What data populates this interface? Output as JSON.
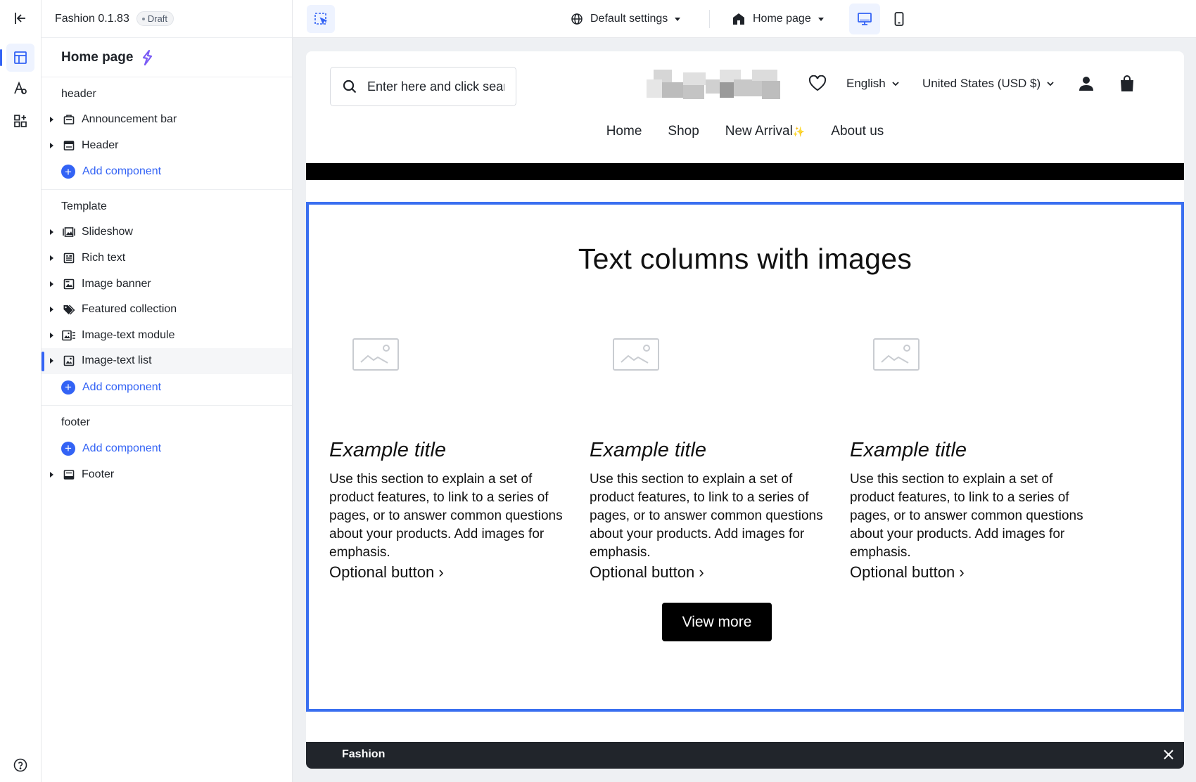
{
  "panel": {
    "app_name": "Fashion 0.1.83",
    "draft_label": "Draft",
    "page_title": "Home page",
    "groups": [
      {
        "title": "header",
        "items": [
          {
            "label": "Announcement bar",
            "icon": "announcement-icon"
          },
          {
            "label": "Header",
            "icon": "header-icon"
          }
        ],
        "add_label": "Add component"
      },
      {
        "title": "Template",
        "items": [
          {
            "label": "Slideshow",
            "icon": "slideshow-icon"
          },
          {
            "label": "Rich text",
            "icon": "rich-text-icon"
          },
          {
            "label": "Image banner",
            "icon": "image-banner-icon"
          },
          {
            "label": "Featured collection",
            "icon": "featured-collection-icon"
          },
          {
            "label": "Image-text module",
            "icon": "image-text-module-icon"
          },
          {
            "label": "Image-text list",
            "icon": "image-text-list-icon",
            "selected": true
          }
        ],
        "add_label": "Add component"
      },
      {
        "title": "footer",
        "add_label": "Add component",
        "items": [
          {
            "label": "Footer",
            "icon": "footer-icon"
          }
        ]
      }
    ]
  },
  "toolbar": {
    "settings_label": "Default settings",
    "page_label": "Home page"
  },
  "preview": {
    "search_placeholder": "Enter here and click search",
    "language": "English",
    "currency": "United States (USD $)",
    "nav": [
      "Home",
      "Shop",
      "New Arrival",
      "About us"
    ],
    "nav_spark": "✨",
    "section_title": "Text columns with images",
    "columns": [
      {
        "title": "Example title",
        "text": "Use this section to explain a set of product features, to link to a series of pages, or to answer common questions about your products. Add images for emphasis.",
        "button": "Optional button ›"
      },
      {
        "title": "Example title",
        "text": "Use this section to explain a set of product features, to link to a series of pages, or to answer common questions about your products. Add images for emphasis.",
        "button": "Optional button ›"
      },
      {
        "title": "Example title",
        "text": "Use this section to explain a set of product features, to link to a series of pages, or to answer common questions about your products. Add images for emphasis.",
        "button": "Optional button ›"
      }
    ],
    "view_more": "View more",
    "footer_label": "Fashion"
  },
  "colors": {
    "accent": "#3363f5",
    "selection_border": "#3a6ff0",
    "footer_bg": "#21252b"
  }
}
